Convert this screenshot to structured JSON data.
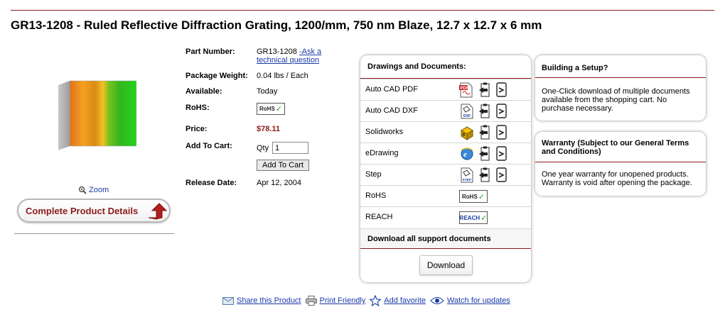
{
  "product": {
    "title": "GR13-1208 - Ruled Reflective Diffraction Grating, 1200/mm, 750 nm Blaze, 12.7 x 12.7 x 6 mm",
    "zoom_label": "Zoom",
    "complete_details_label": "Complete Product Details"
  },
  "details": {
    "part_number_label": "Part Number:",
    "part_number": "GR13-1208",
    "ask_link_line1": "-Ask a",
    "ask_link_line2": "technical question",
    "package_weight_label": "Package Weight:",
    "package_weight": "0.04 lbs / Each",
    "available_label": "Available:",
    "available": "Today",
    "rohs_label": "RoHS:",
    "rohs_badge": "RoHS",
    "price_label": "Price:",
    "price": "$78.11",
    "add_to_cart_label": "Add To Cart:",
    "qty_label": "Qty",
    "qty_value": "1",
    "add_to_cart_button": "Add To Cart",
    "release_date_label": "Release Date:",
    "release_date": "Apr 12, 2004"
  },
  "documents": {
    "heading": "Drawings and Documents:",
    "rows": [
      {
        "name": "Auto CAD PDF",
        "icon": "pdf-icon"
      },
      {
        "name": "Auto CAD DXF",
        "icon": "dxf-icon"
      },
      {
        "name": "Solidworks",
        "icon": "solidworks-icon"
      },
      {
        "name": "eDrawing",
        "icon": "edrawing-icon"
      },
      {
        "name": "Step",
        "icon": "step-icon"
      },
      {
        "name": "RoHS",
        "icon": "rohs-badge"
      },
      {
        "name": "REACH",
        "icon": "reach-badge"
      }
    ],
    "rohs_badge_text": "RoHS",
    "reach_badge_text": "REACH",
    "download_all_label": "Download all support documents",
    "download_button": "Download"
  },
  "setup": {
    "heading": "Building a Setup?",
    "body_line1": "One-Click download of multiple documents",
    "body_line2": "available from the shopping cart. No",
    "body_line3": "purchase necessary."
  },
  "warranty": {
    "heading_line1": "Warranty (Subject to our General Terms",
    "heading_line2": "and Conditions)",
    "body_line1": "One year warranty for unopened products.",
    "body_line2": "Warranty is void after opening the package."
  },
  "footer": {
    "share": "Share this Product",
    "print": "Print Friendly",
    "favorite": "Add favorite",
    "watch": "Watch for updates"
  },
  "colors": {
    "brand_dark_red": "#8b1a1a",
    "link_blue": "#1a3aa8",
    "check_green": "#2e9b2e"
  }
}
